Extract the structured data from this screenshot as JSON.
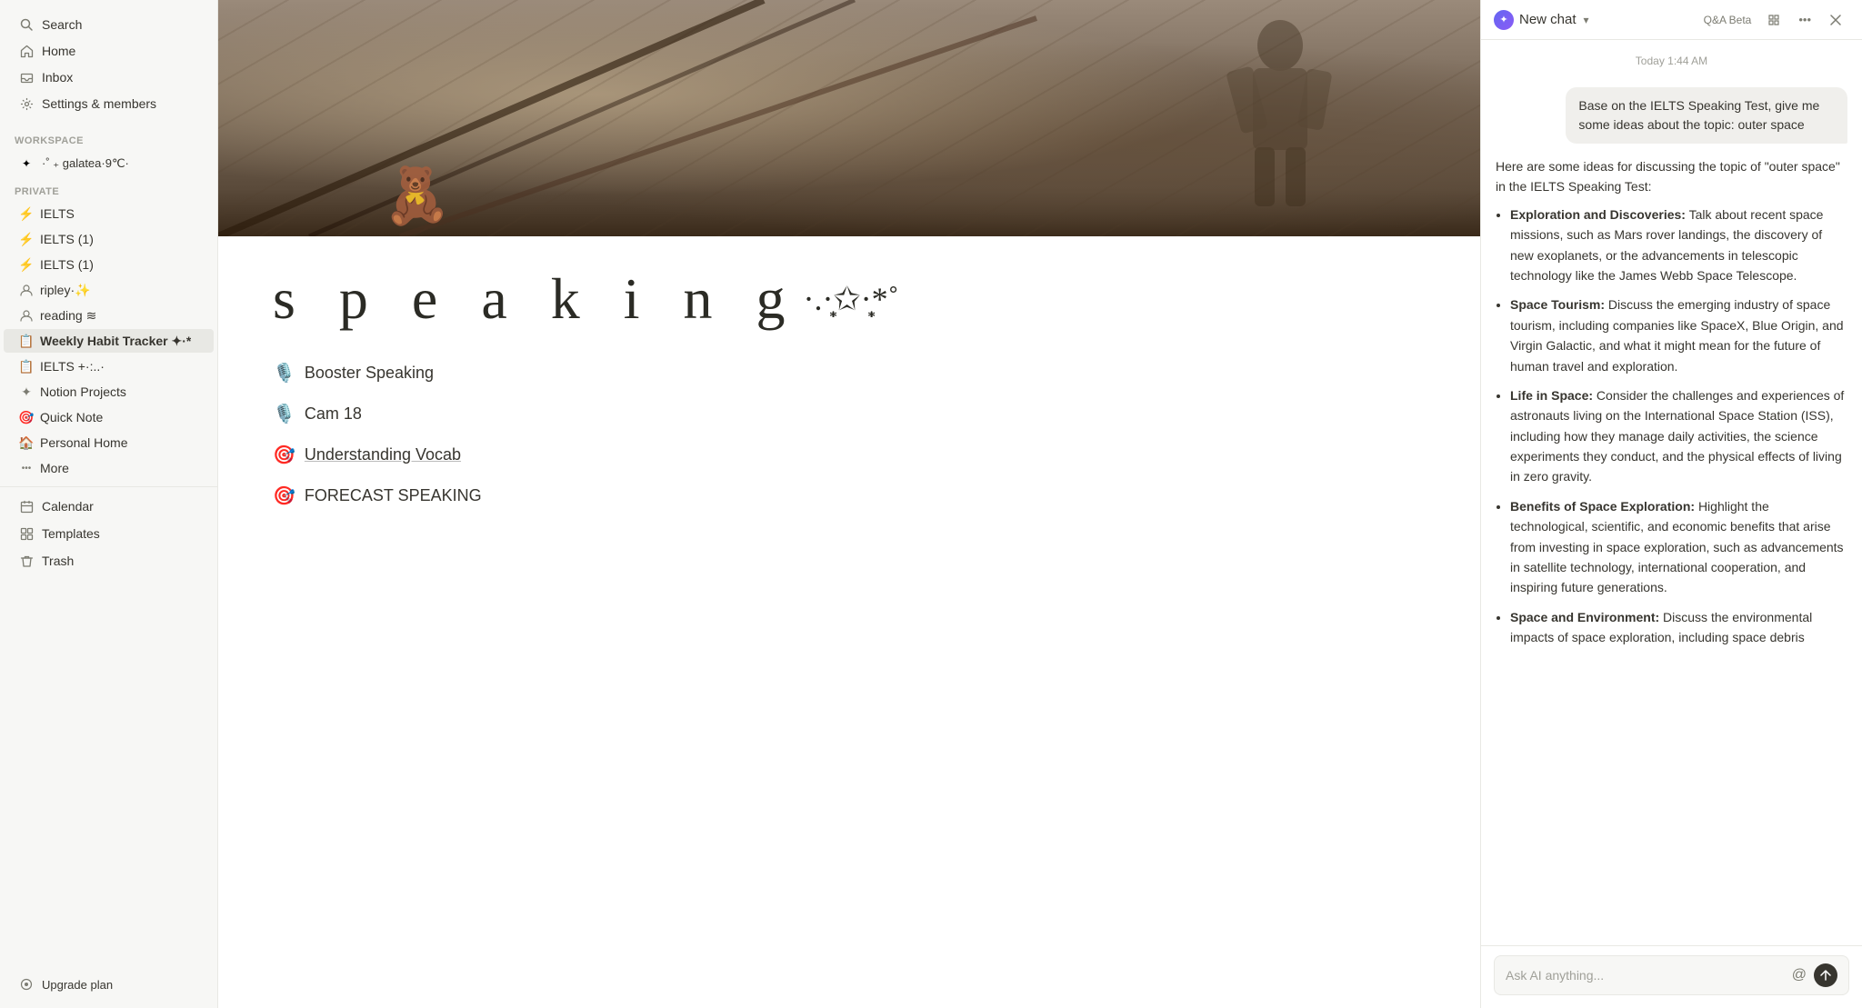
{
  "sidebar": {
    "search_label": "Search",
    "home_label": "Home",
    "inbox_label": "Inbox",
    "settings_label": "Settings & members",
    "workspace_label": "Workspace",
    "workspace_name": "·˚ ₊ galatea·9℃·",
    "private_label": "Private",
    "pages": [
      {
        "name": "IELTS",
        "icon": "⚡",
        "bold": false
      },
      {
        "name": "IELTS (1)",
        "icon": "⚡",
        "bold": false
      },
      {
        "name": "IELTS (1)",
        "icon": "⚡",
        "bold": false
      },
      {
        "name": "ripley·✨",
        "icon": "👤",
        "bold": false
      },
      {
        "name": "reading ≋",
        "icon": "👤",
        "bold": false
      },
      {
        "name": "Weekly Habit Tracker ✦·*",
        "icon": "📋",
        "bold": true
      },
      {
        "name": "IELTS +·:..·",
        "icon": "📋",
        "bold": false
      },
      {
        "name": "Notion Projects",
        "icon": "✦",
        "bold": false
      },
      {
        "name": "Quick Note",
        "icon": "🎯",
        "bold": false
      },
      {
        "name": "Personal Home",
        "icon": "🏠",
        "bold": false
      },
      {
        "name": "More",
        "icon": "···",
        "bold": false
      }
    ],
    "calendar_label": "Calendar",
    "templates_label": "Templates",
    "trash_label": "Trash",
    "upgrade_label": "Upgrade plan"
  },
  "main": {
    "speaking_title": "s p e a k i n g",
    "speaking_deco": "·.·̩̩͙✩·̩̩͙*˚",
    "links": [
      {
        "emoji": "🎙️",
        "text": "Booster Speaking",
        "underline": false
      },
      {
        "emoji": "🎙️",
        "text": "Cam 18",
        "underline": false
      },
      {
        "emoji": "🎯",
        "text": "Understanding Vocab",
        "underline": true
      },
      {
        "emoji": "🎯",
        "text": "FORECAST SPEAKING",
        "underline": false
      }
    ]
  },
  "chat": {
    "title": "New chat",
    "qa_beta": "Q&A Beta",
    "timestamp": "Today 1:44 AM",
    "user_message": "Base on the IELTS Speaking Test, give me some ideas about the topic: outer space",
    "ai_intro": "Here are some ideas for discussing the topic of \"outer space\" in the IELTS Speaking Test:",
    "ai_points": [
      {
        "bold": "Exploration and Discoveries:",
        "text": " Talk about recent space missions, such as Mars rover landings, the discovery of new exoplanets, or the advancements in telescopic technology like the James Webb Space Telescope."
      },
      {
        "bold": "Space Tourism:",
        "text": " Discuss the emerging industry of space tourism, including companies like SpaceX, Blue Origin, and Virgin Galactic, and what it might mean for the future of human travel and exploration."
      },
      {
        "bold": "Life in Space:",
        "text": " Consider the challenges and experiences of astronauts living on the International Space Station (ISS), including how they manage daily activities, the science experiments they conduct, and the physical effects of living in zero gravity."
      },
      {
        "bold": "Benefits of Space Exploration:",
        "text": " Highlight the technological, scientific, and economic benefits that arise from investing in space exploration, such as advancements in satellite technology, international cooperation, and inspiring future generations."
      },
      {
        "bold": "Space and Environment:",
        "text": " Discuss the environmental impacts of space exploration, including space debris"
      }
    ],
    "input_placeholder": "Ask AI anything..."
  }
}
